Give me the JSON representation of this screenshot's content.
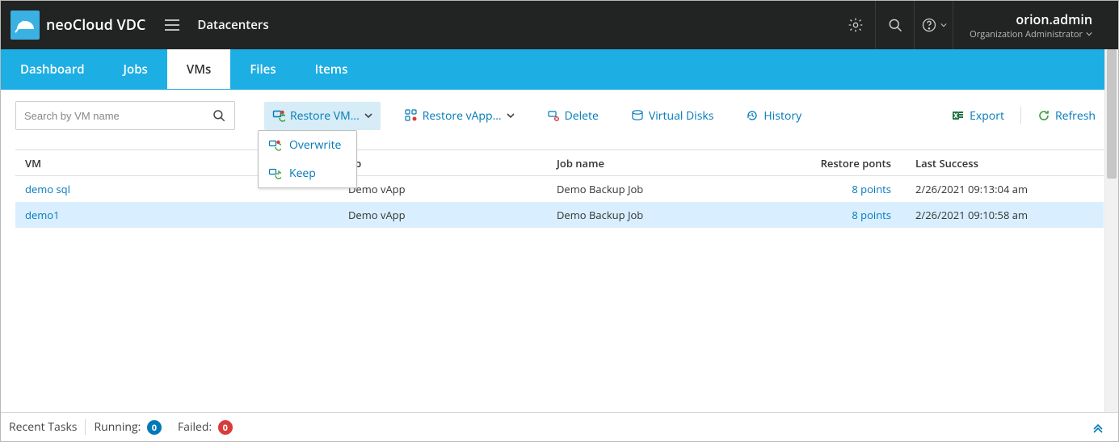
{
  "header": {
    "product": "neoCloud VDC",
    "breadcrumb": "Datacenters",
    "user_name": "orion.admin",
    "user_role": "Organization Administrator"
  },
  "tabs": [
    {
      "label": "Dashboard",
      "active": false
    },
    {
      "label": "Jobs",
      "active": false
    },
    {
      "label": "VMs",
      "active": true
    },
    {
      "label": "Files",
      "active": false
    },
    {
      "label": "Items",
      "active": false
    }
  ],
  "search": {
    "placeholder": "Search by VM name"
  },
  "toolbar": {
    "restore_vm": "Restore VM...",
    "restore_vapp": "Restore vApp...",
    "delete": "Delete",
    "virtual_disks": "Virtual Disks",
    "history": "History",
    "export": "Export",
    "refresh": "Refresh"
  },
  "dropdown": {
    "overwrite": "Overwrite",
    "keep": "Keep"
  },
  "columns": {
    "vm": "VM",
    "vapp": "pp",
    "job": "Job name",
    "rp": "Restore ponts",
    "ls": "Last Success"
  },
  "rows": [
    {
      "vm": "demo sql",
      "vapp": "Demo vApp",
      "job": "Demo Backup Job",
      "rp": "8 points",
      "ls": "2/26/2021 09:13:04 am",
      "selected": false
    },
    {
      "vm": "demo1",
      "vapp": "Demo vApp",
      "job": "Demo Backup Job",
      "rp": "8 points",
      "ls": "2/26/2021 09:10:58 am",
      "selected": true
    }
  ],
  "footer": {
    "tasks": "Recent Tasks",
    "running_label": "Running:",
    "running_count": "0",
    "failed_label": "Failed:",
    "failed_count": "0"
  }
}
